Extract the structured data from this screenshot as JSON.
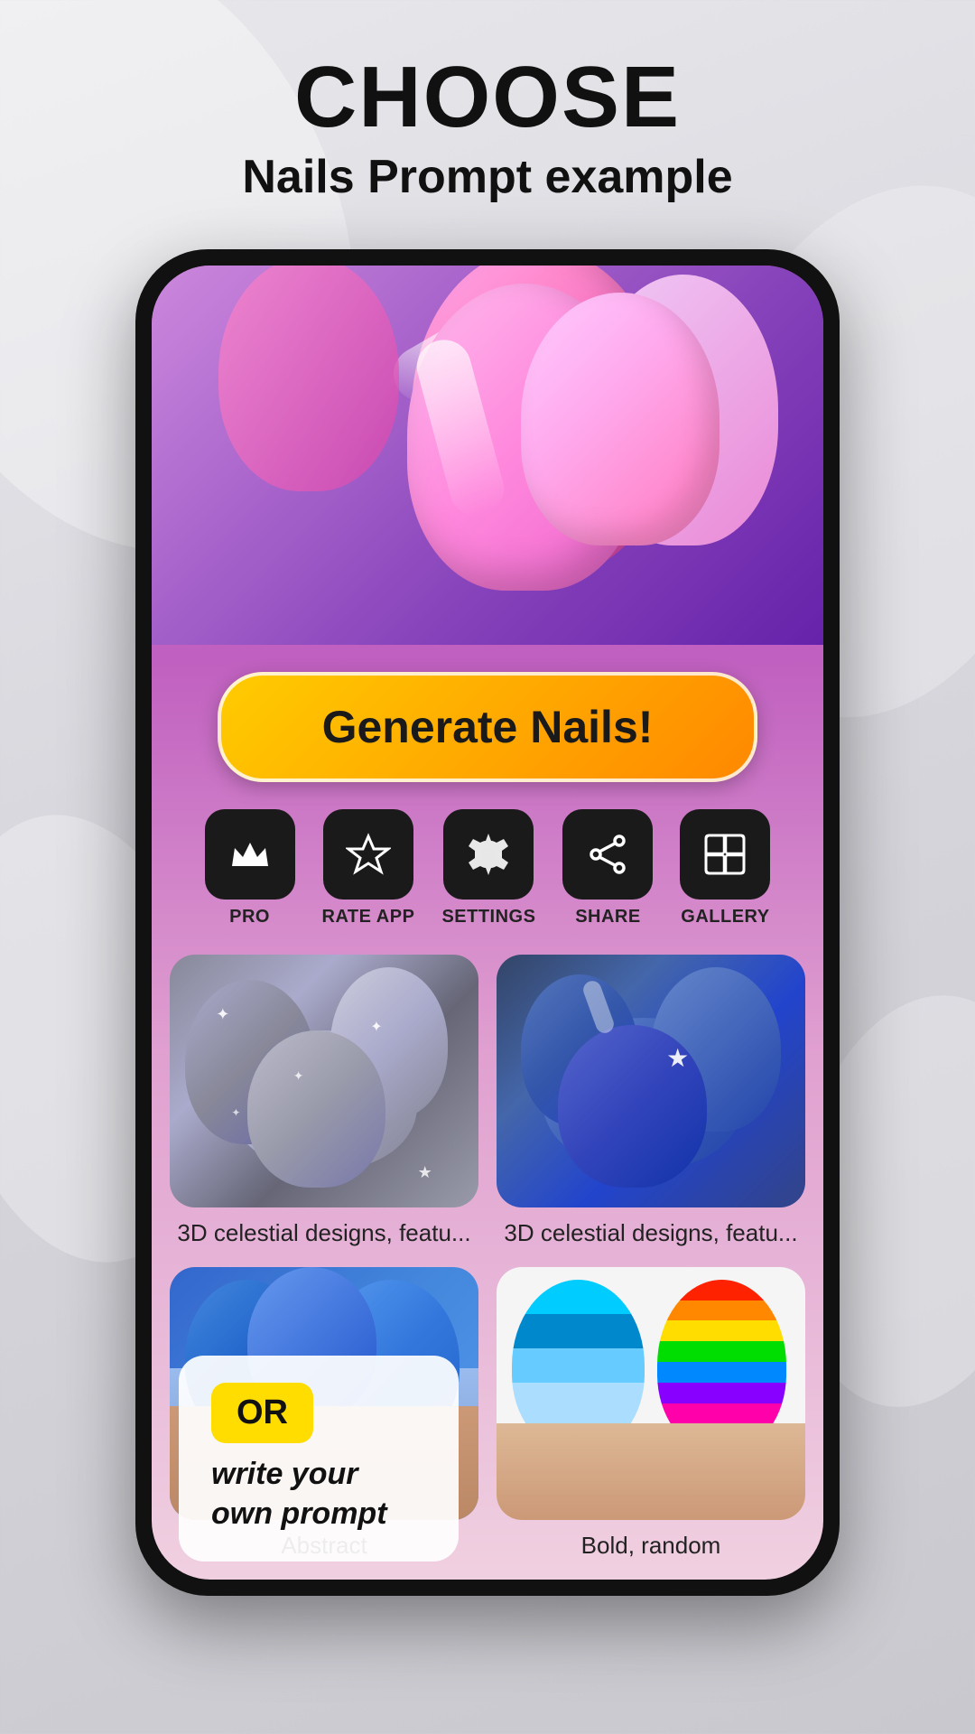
{
  "page": {
    "title": "CHOOSE",
    "subtitle": "Nails Prompt example"
  },
  "generate_button": {
    "label": "Generate Nails!"
  },
  "actions": [
    {
      "id": "pro",
      "icon": "♛",
      "label": "PRO"
    },
    {
      "id": "rate-app",
      "icon": "☆",
      "label": "RATE APP"
    },
    {
      "id": "settings",
      "icon": "⚙",
      "label": "SETTINGS"
    },
    {
      "id": "share",
      "icon": "◁",
      "label": "SHARE"
    },
    {
      "id": "gallery",
      "icon": "▦",
      "label": "GALLERY"
    }
  ],
  "grid_items": [
    {
      "id": "item-1",
      "label": "3D celestial designs, featu...",
      "style": "silver-glitter"
    },
    {
      "id": "item-2",
      "label": "3D celestial designs, featu...",
      "style": "blue-chrome"
    },
    {
      "id": "item-3",
      "label": "Abstract",
      "style": "blue-matte"
    },
    {
      "id": "item-4",
      "label": "Bold, random",
      "style": "colorful-stripes"
    }
  ],
  "or_section": {
    "badge": "OR",
    "text": "write your own prompt"
  },
  "colors": {
    "orange_btn": "#ffaa00",
    "dark_icon_bg": "#1a1a1a",
    "background": "#dcdce0"
  }
}
